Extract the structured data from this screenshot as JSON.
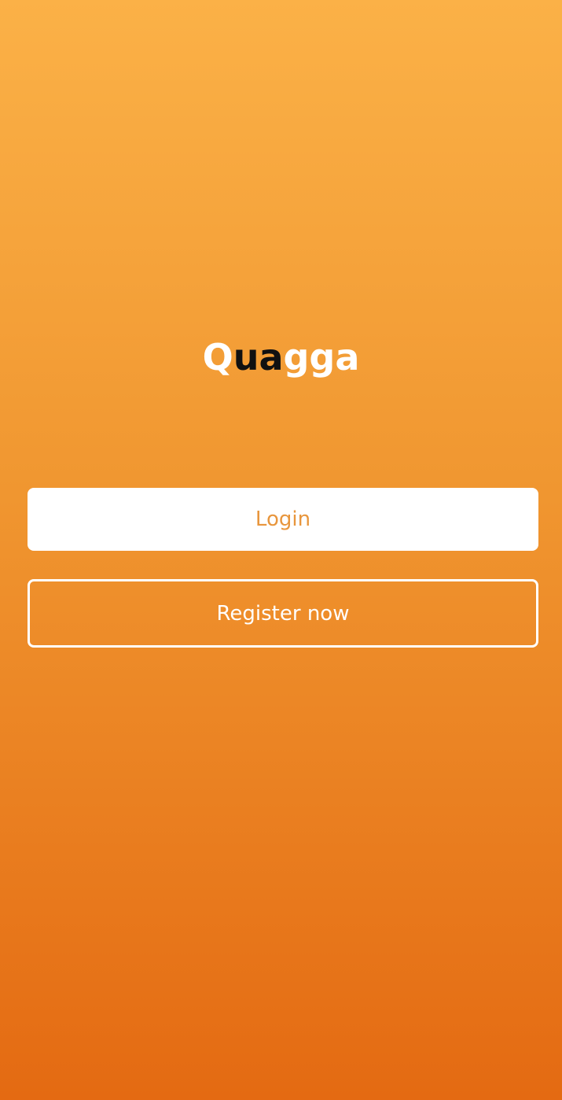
{
  "app": {
    "logo": {
      "segments": [
        {
          "text": "Q",
          "color": "#FFFFFF"
        },
        {
          "text": "ua",
          "color": "#111111"
        },
        {
          "text": "gga",
          "color": "#FFFFFF"
        }
      ]
    }
  },
  "actions": {
    "login_label": "Login",
    "register_label": "Register now"
  },
  "colors": {
    "gradient_top": "#FBB147",
    "gradient_mid": "#F09630",
    "gradient_bottom": "#E46A12",
    "login_text": "#E8963D",
    "register_text": "#FFFFFF",
    "register_border": "#FFFFFF"
  }
}
